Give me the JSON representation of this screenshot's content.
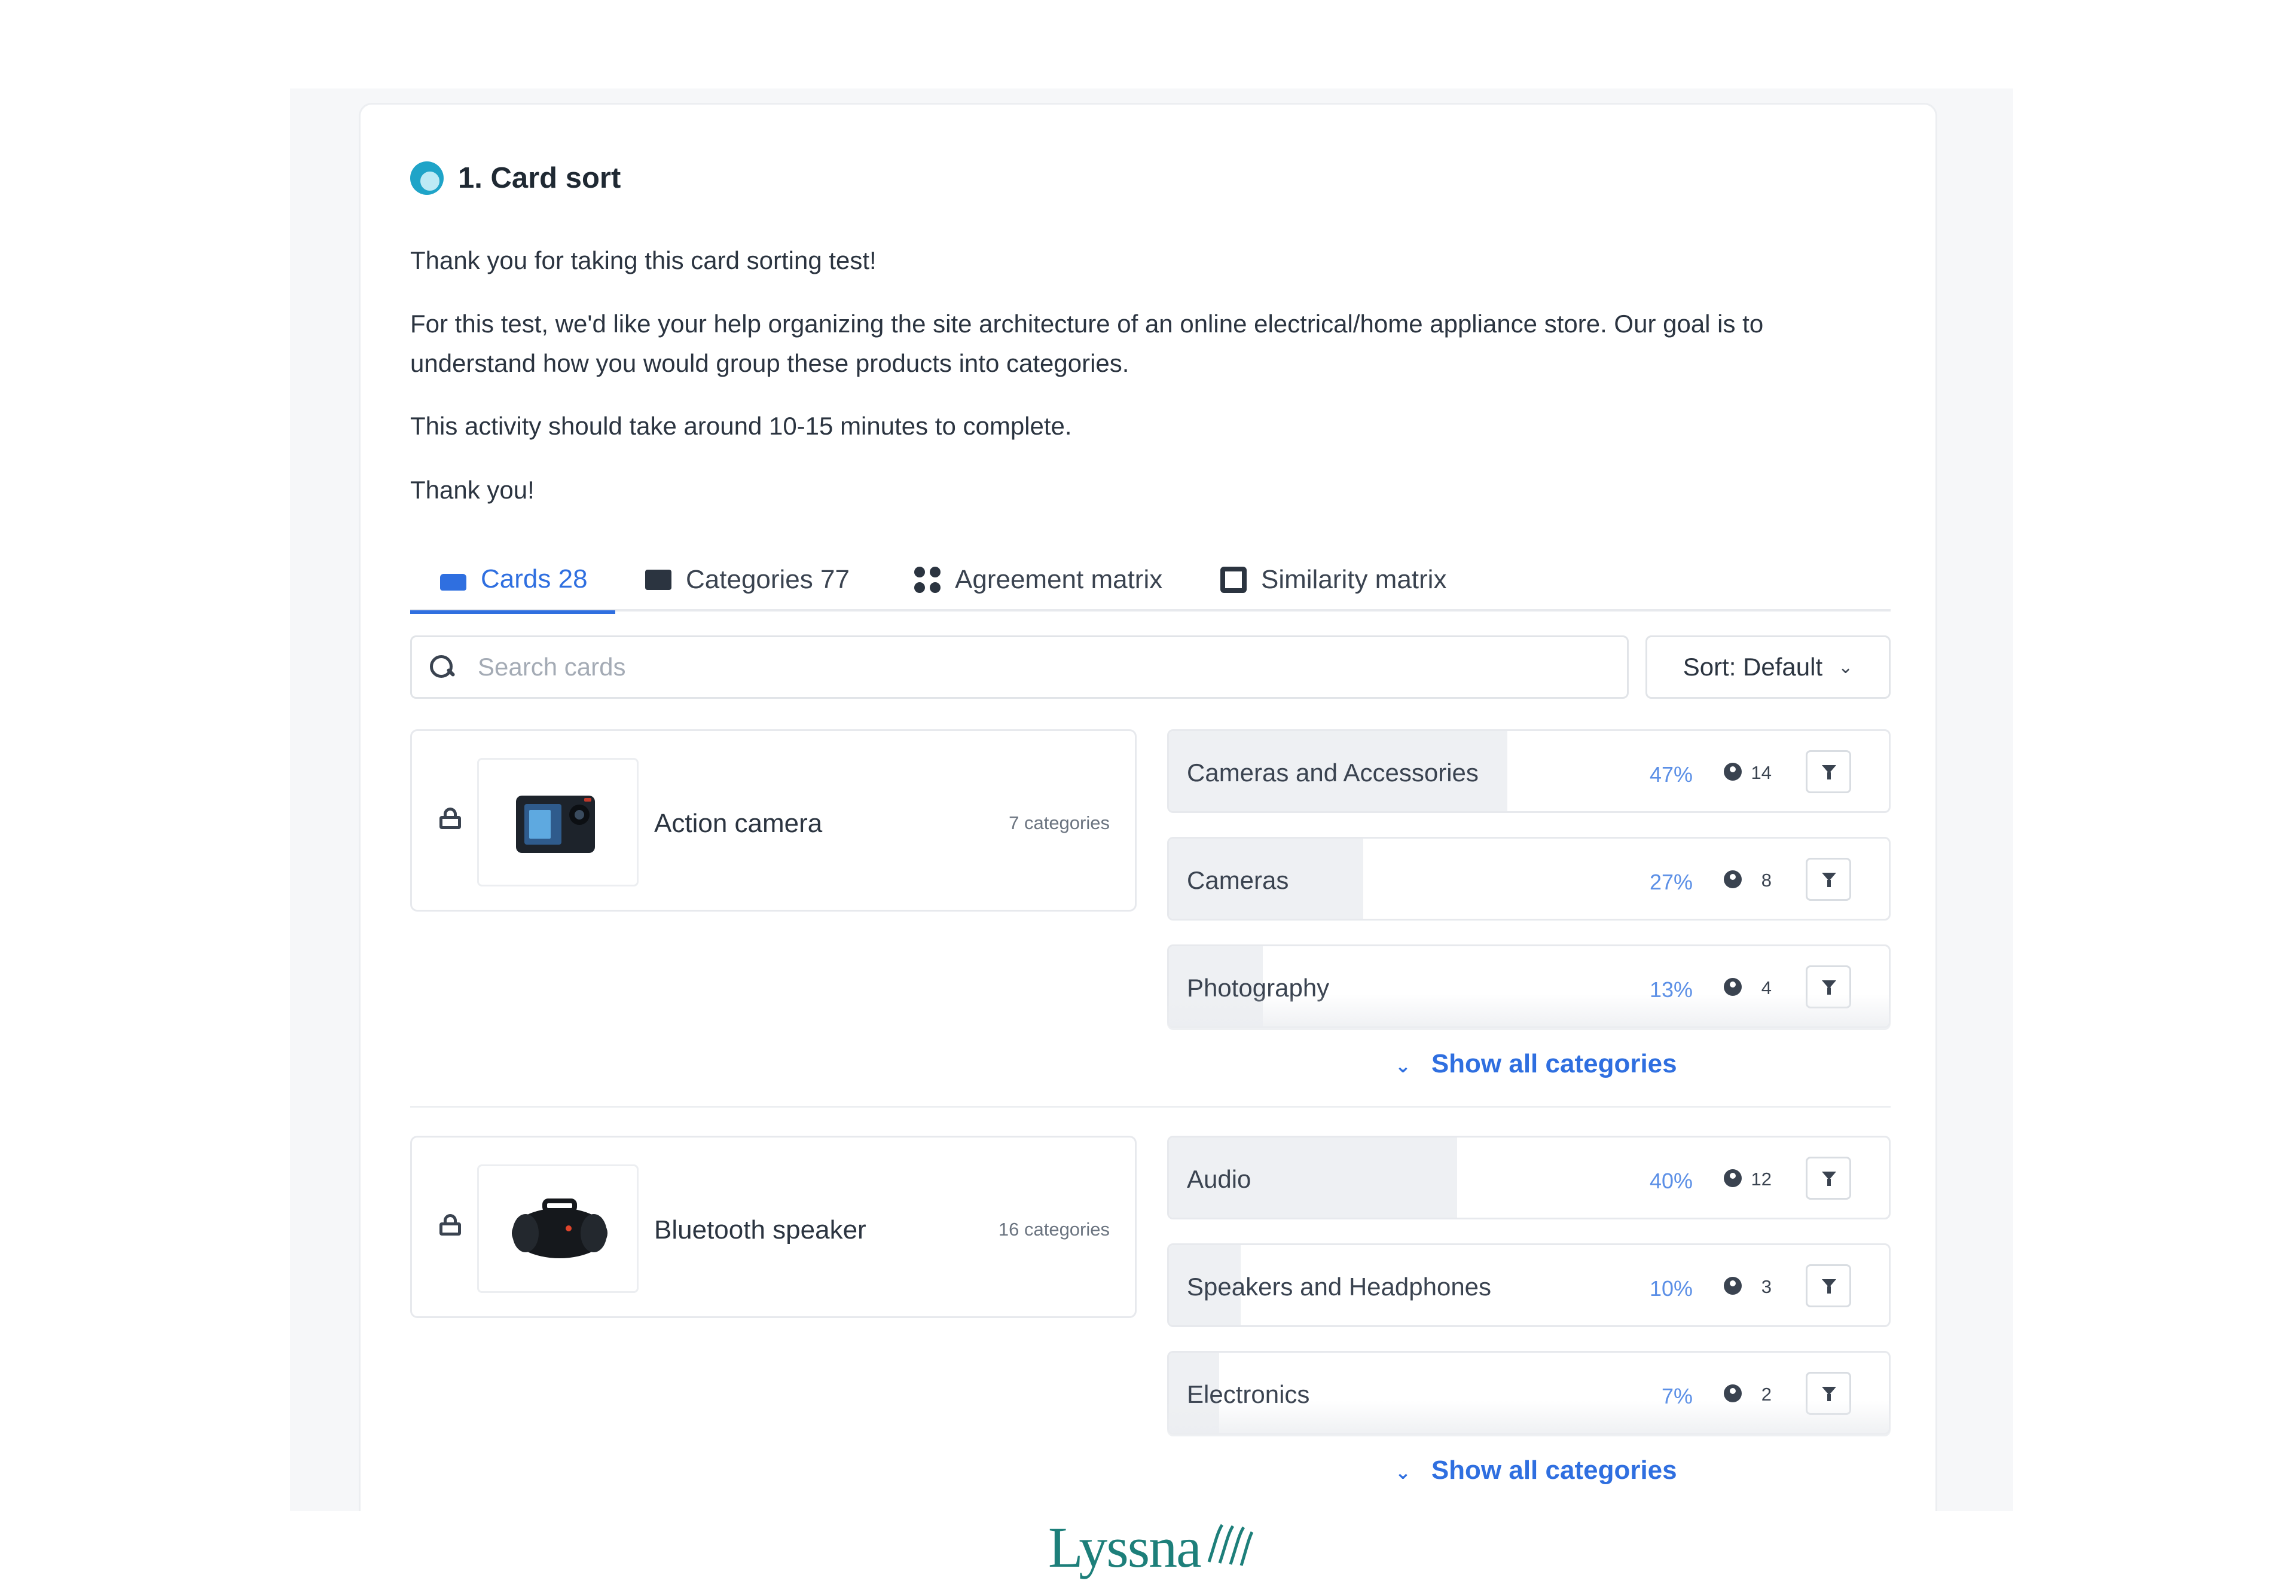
{
  "task": {
    "title": "1. Card sort"
  },
  "intro": {
    "p1": "Thank you for taking this card sorting test!",
    "p2": "For this test, we'd like your help organizing the site architecture of an online electrical/home appliance store. Our goal is to understand how you would group these products into categories.",
    "p3": "This activity should take around 10-15 minutes to complete.",
    "p4": "Thank you!"
  },
  "tabs": [
    {
      "label": "Cards 28",
      "active": true,
      "icon": "cards-icon"
    },
    {
      "label": "Categories 77",
      "active": false,
      "icon": "folder-icon"
    },
    {
      "label": "Agreement matrix",
      "active": false,
      "icon": "grid-icon"
    },
    {
      "label": "Similarity matrix",
      "active": false,
      "icon": "similarity-icon"
    }
  ],
  "search": {
    "placeholder": "Search cards",
    "value": ""
  },
  "sort": {
    "label": "Sort: Default"
  },
  "cards": [
    {
      "name": "Action camera",
      "count": "7 categories",
      "image": "action-camera-image",
      "categories": [
        {
          "name": "Cameras and Accessories",
          "pct": "47%",
          "share": 0.47,
          "count": "14"
        },
        {
          "name": "Cameras",
          "pct": "27%",
          "share": 0.27,
          "count": "8"
        },
        {
          "name": "Photography",
          "pct": "13%",
          "share": 0.13,
          "count": "4"
        }
      ],
      "show_all": "Show all categories"
    },
    {
      "name": "Bluetooth speaker",
      "count": "16 categories",
      "image": "bluetooth-speaker-image",
      "categories": [
        {
          "name": "Audio",
          "pct": "40%",
          "share": 0.4,
          "count": "12"
        },
        {
          "name": "Speakers and Headphones",
          "pct": "10%",
          "share": 0.1,
          "count": "3"
        },
        {
          "name": "Electronics",
          "pct": "7%",
          "share": 0.07,
          "count": "2"
        }
      ],
      "show_all": "Show all categories"
    }
  ],
  "brand": {
    "logo": "Lyssna"
  },
  "colors": {
    "accent": "#2f6fe0",
    "percent": "#5b8fe6",
    "brand": "#1d7f7a",
    "task_icon": "#1fa4c8"
  }
}
